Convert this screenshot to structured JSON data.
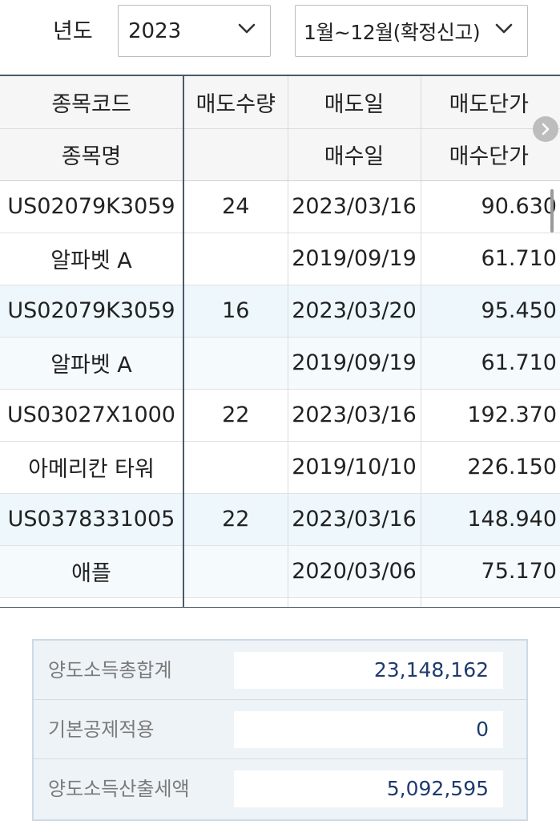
{
  "filter": {
    "year_label": "년도",
    "year_value": "2023",
    "period_value": "1월~12월(확정신고)"
  },
  "table": {
    "headers": {
      "row1": [
        "종목코드",
        "매도수량",
        "매도일",
        "매도단가"
      ],
      "row2": [
        "종목명",
        "",
        "매수일",
        "매수단가"
      ]
    },
    "rows": [
      [
        "US02079K3059",
        "24",
        "2023/03/16",
        "90.630"
      ],
      [
        "알파벳 A",
        "",
        "2019/09/19",
        "61.710"
      ],
      [
        "US02079K3059",
        "16",
        "2023/03/20",
        "95.450"
      ],
      [
        "알파벳 A",
        "",
        "2019/09/19",
        "61.710"
      ],
      [
        "US03027X1000",
        "22",
        "2023/03/16",
        "192.370"
      ],
      [
        "아메리칸 타워",
        "",
        "2019/10/10",
        "226.150"
      ],
      [
        "US0378331005",
        "22",
        "2023/03/16",
        "148.940"
      ],
      [
        "애플",
        "",
        "2020/03/06",
        "75.170"
      ],
      [
        "",
        "",
        "",
        ""
      ]
    ]
  },
  "summary": [
    {
      "label": "양도소득총합계",
      "value": "23,148,162"
    },
    {
      "label": "기본공제적용",
      "value": "0"
    },
    {
      "label": "양도소득산출세액",
      "value": "5,092,595"
    }
  ],
  "icons": {
    "dropdown": "chevron-down-icon",
    "scroll": "chevron-right-icon"
  },
  "colors": {
    "accent_text": "#1f3a6e",
    "alt_row": "#eef7fb",
    "summary_bg": "#eef3f8"
  }
}
